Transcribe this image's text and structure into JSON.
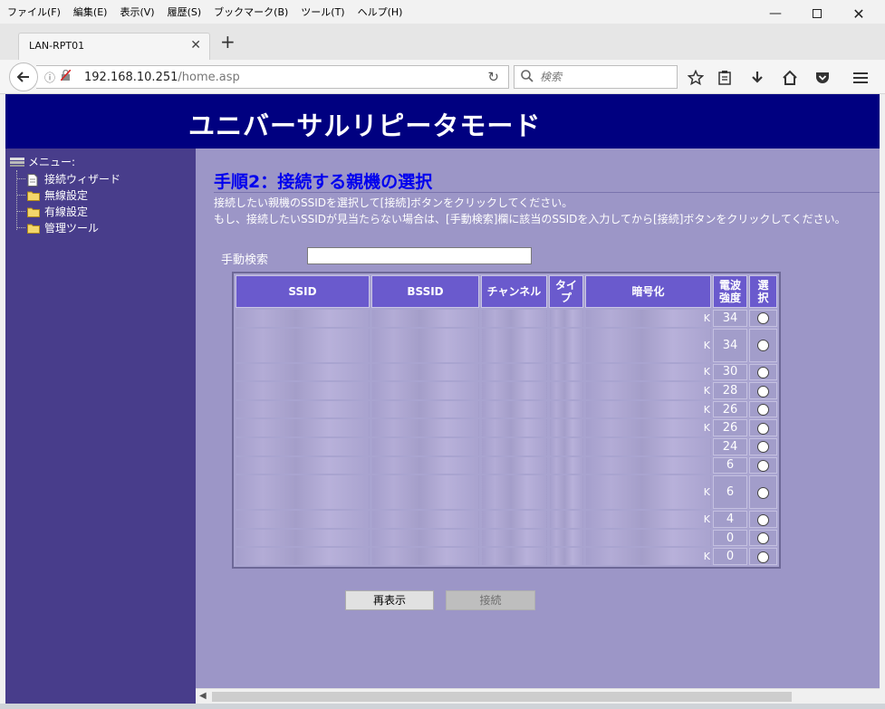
{
  "browser": {
    "menus": [
      {
        "label": "ファイル(F)"
      },
      {
        "label": "編集(E)"
      },
      {
        "label": "表示(V)"
      },
      {
        "label": "履歴(S)"
      },
      {
        "label": "ブックマーク(B)"
      },
      {
        "label": "ツール(T)"
      },
      {
        "label": "ヘルプ(H)"
      }
    ],
    "tab_title": "LAN-RPT01",
    "url_host": "192.168.10.251",
    "url_path": "/home.asp",
    "search_placeholder": "検索"
  },
  "page": {
    "banner_title": "ユニバーサルリピータモード",
    "sidebar": {
      "root_label": "メニュー:",
      "items": [
        {
          "label": "接続ウィザード",
          "icon": "document-icon"
        },
        {
          "label": "無線設定",
          "icon": "folder-icon"
        },
        {
          "label": "有線設定",
          "icon": "folder-icon"
        },
        {
          "label": "管理ツール",
          "icon": "folder-icon"
        }
      ]
    },
    "step_title": "手順2：接続する親機の選択",
    "desc_line1": "接続したい親機のSSIDを選択して[接続]ボタンをクリックしてください。",
    "desc_line2": "もし、接続したいSSIDが見当たらない場合は、[手動検索]欄に該当のSSIDを入力してから[接続]ボタンをクリックしてください。",
    "manual_search_label": "手動検索",
    "manual_search_value": "",
    "table": {
      "headers": {
        "ssid": "SSID",
        "bssid": "BSSID",
        "channel": "チャンネル",
        "type": "タイプ",
        "encryption": "暗号化",
        "signal": "電波強度",
        "select": "選択"
      },
      "rows": [
        {
          "enc": "K",
          "signal": "34",
          "tall": false
        },
        {
          "enc": "K",
          "signal": "34",
          "tall": true
        },
        {
          "enc": "K",
          "signal": "30",
          "tall": false
        },
        {
          "enc": "K",
          "signal": "28",
          "tall": false
        },
        {
          "enc": "K",
          "signal": "26",
          "tall": false
        },
        {
          "enc": "K",
          "signal": "26",
          "tall": false
        },
        {
          "enc": "",
          "signal": "24",
          "tall": false
        },
        {
          "enc": "",
          "signal": "6",
          "tall": false
        },
        {
          "enc": "K",
          "signal": "6",
          "tall": true
        },
        {
          "enc": "K",
          "signal": "4",
          "tall": false
        },
        {
          "enc": "",
          "signal": "0",
          "tall": false
        },
        {
          "enc": "K",
          "signal": "0",
          "tall": false
        }
      ]
    },
    "buttons": {
      "refresh": "再表示",
      "connect": "接続"
    }
  },
  "colors": {
    "banner": "#000080",
    "sidebar": "#483d8b",
    "content": "#9c96c7",
    "table_header": "#6a5acd",
    "step_title": "#0000ee"
  }
}
